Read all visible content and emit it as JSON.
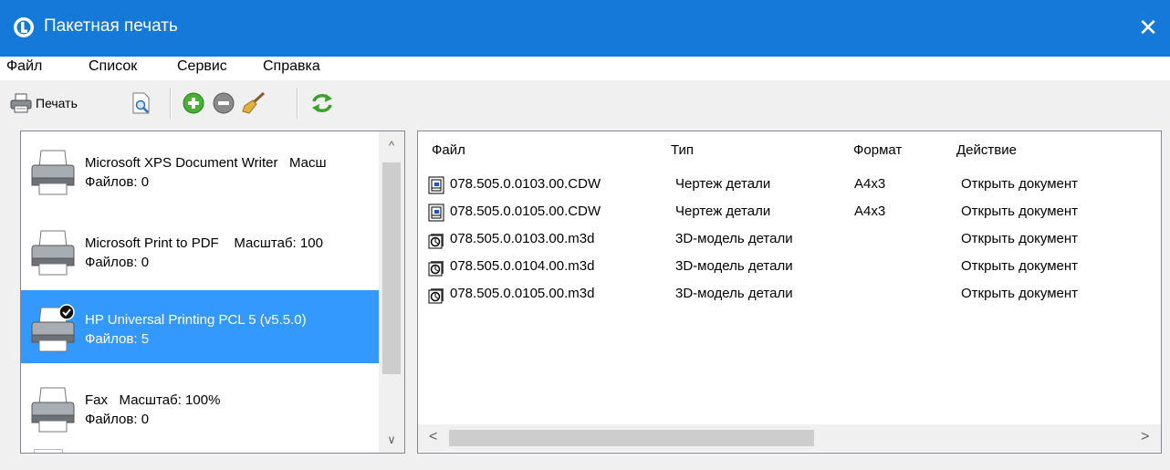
{
  "window": {
    "title": "Пакетная печать",
    "close_symbol": "✕"
  },
  "menu": [
    "Файл",
    "Список",
    "Сервис",
    "Справка"
  ],
  "toolbar": {
    "print_label": "Печать"
  },
  "printers": [
    {
      "name": "Microsoft XPS Document Writer",
      "scale": "Масш",
      "files": "Файлов: 0",
      "selected": false,
      "default": false
    },
    {
      "name": "Microsoft Print to PDF",
      "scale": "Масштаб: 100",
      "files": "Файлов: 0",
      "selected": false,
      "default": false
    },
    {
      "name": "HP Universal Printing PCL 5 (v5.5.0)",
      "scale": "",
      "files": "Файлов: 5",
      "selected": true,
      "default": true
    },
    {
      "name": "Fax",
      "scale": "Масштаб: 100%",
      "files": "Файлов: 0",
      "selected": false,
      "default": false
    }
  ],
  "files_table": {
    "columns": [
      "Файл",
      "Тип",
      "Формат",
      "Действие"
    ],
    "rows": [
      {
        "icon": "cdw-drawing-icon",
        "file": "078.505.0.0103.00.CDW",
        "type": "Чертеж детали",
        "format": "A4x3",
        "action": "Открыть документ"
      },
      {
        "icon": "cdw-drawing-icon",
        "file": "078.505.0.0105.00.CDW",
        "type": "Чертеж детали",
        "format": "A4x3",
        "action": "Открыть документ"
      },
      {
        "icon": "m3d-model-icon",
        "file": "078.505.0.0103.00.m3d",
        "type": "3D-модель детали",
        "format": "",
        "action": "Открыть документ"
      },
      {
        "icon": "m3d-model-icon",
        "file": "078.505.0.0104.00.m3d",
        "type": "3D-модель детали",
        "format": "",
        "action": "Открыть документ"
      },
      {
        "icon": "m3d-model-icon",
        "file": "078.505.0.0105.00.m3d",
        "type": "3D-модель детали",
        "format": "",
        "action": "Открыть документ"
      }
    ]
  },
  "colors": {
    "titlebar": "#1479d9",
    "selection": "#3399ff"
  }
}
